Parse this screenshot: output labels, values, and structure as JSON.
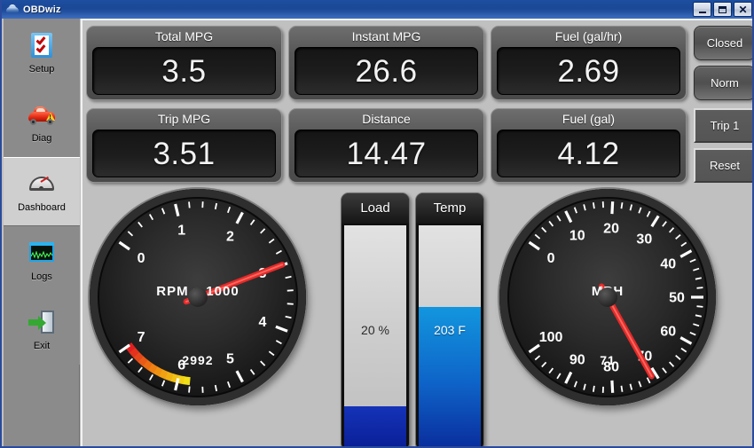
{
  "window": {
    "title": "OBDwiz",
    "app_icon": "car-icon",
    "controls": {
      "minimize": "minimize-icon",
      "maximize": "maximize-icon",
      "close": "close-icon"
    }
  },
  "sidebar": {
    "items": [
      {
        "label": "Setup",
        "icon": "clipboard-check-icon",
        "selected": false
      },
      {
        "label": "Diag",
        "icon": "car-warning-icon",
        "selected": false
      },
      {
        "label": "Dashboard",
        "icon": "gauge-icon",
        "selected": true
      },
      {
        "label": "Logs",
        "icon": "waveform-icon",
        "selected": false
      },
      {
        "label": "Exit",
        "icon": "exit-door-icon",
        "selected": false
      }
    ]
  },
  "readouts": {
    "row1": [
      {
        "title": "Total MPG",
        "value": "3.5"
      },
      {
        "title": "Instant MPG",
        "value": "26.6"
      },
      {
        "title": "Fuel (gal/hr)",
        "value": "2.69"
      }
    ],
    "row2": [
      {
        "title": "Trip MPG",
        "value": "3.51"
      },
      {
        "title": "Distance",
        "value": "14.47"
      },
      {
        "title": "Fuel (gal)",
        "value": "4.12"
      }
    ]
  },
  "buttons": {
    "loop_status": "Closed",
    "fuel_status": "Norm",
    "trip_select": "Trip 1",
    "reset": "Reset"
  },
  "chart_data": [
    {
      "type": "gauge",
      "name": "tachometer",
      "title": "RPM x 1000",
      "value": 2992,
      "readout": "2992",
      "needle_value": 2992,
      "unit": "RPM",
      "min": 0,
      "max": 7000,
      "tick_labels": [
        "0",
        "1",
        "2",
        "3",
        "4",
        "5",
        "6",
        "7"
      ],
      "major_step": 1000,
      "minor_per_major": 4,
      "start_angle_deg": 215,
      "end_angle_deg": 505,
      "redline_start": 5800,
      "redline_end": 7000,
      "redline_colors": [
        "#f2e017",
        "#f08a10",
        "#e02020"
      ]
    },
    {
      "type": "gauge",
      "name": "speedometer",
      "title": "MPH",
      "value": 71,
      "readout": "71",
      "needle_value": 71,
      "unit": "MPH",
      "min": 0,
      "max": 100,
      "tick_labels": [
        "0",
        "10",
        "20",
        "30",
        "40",
        "50",
        "60",
        "70",
        "80",
        "90",
        "100"
      ],
      "major_step": 10,
      "minor_per_major": 4,
      "start_angle_deg": 215,
      "end_angle_deg": 505
    },
    {
      "type": "bar",
      "name": "engine-load",
      "title": "Load",
      "value": 20,
      "display": "20 %",
      "unit": "%",
      "min": 0,
      "max": 100,
      "fill_percent": 18,
      "fill_color": "#1533b8",
      "orientation": "vertical"
    },
    {
      "type": "bar",
      "name": "coolant-temp",
      "title": "Temp",
      "value": 203,
      "display": "203 F",
      "unit": "F",
      "min": 0,
      "max": 300,
      "fill_percent": 63,
      "fill_color": "#0e63c8",
      "orientation": "vertical"
    }
  ]
}
